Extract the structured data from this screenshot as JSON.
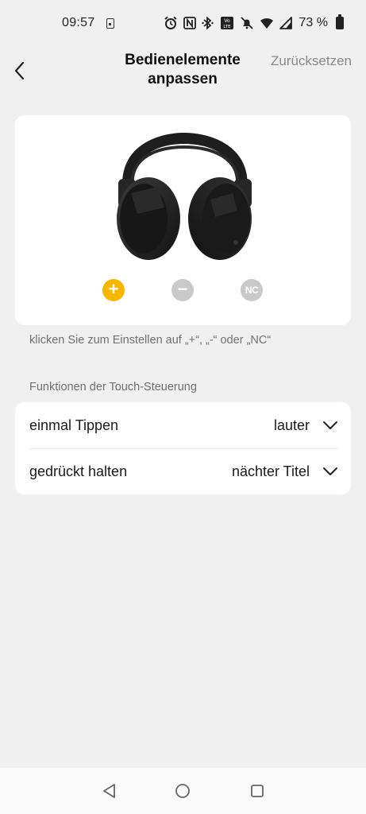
{
  "status_bar": {
    "time": "09:57",
    "battery_percent": "73 %",
    "icons": [
      "sim-card-icon",
      "alarm-icon",
      "nfc-icon",
      "bluetooth-icon",
      "volte-icon",
      "mute-icon",
      "wifi-icon",
      "signal-icon",
      "battery-icon"
    ]
  },
  "header": {
    "title_line1": "Bedienelemente",
    "title_line2": "anpassen",
    "reset_label": "Zurücksetzen",
    "back_icon": "chevron-left-icon"
  },
  "product": {
    "controls": {
      "plus": "+",
      "minus": "−",
      "nc": "NC",
      "active": "plus",
      "active_color": "#f5b700",
      "inactive_color": "#c9c9c9"
    }
  },
  "hint": "klicken Sie zum Einstellen auf „+“, „-“ oder „NC“",
  "section": {
    "label": "Funktionen der Touch-Steuerung",
    "rows": [
      {
        "label": "einmal Tippen",
        "value": "lauter"
      },
      {
        "label": "gedrückt halten",
        "value": "nächter Titel"
      }
    ]
  },
  "nav": {
    "icons": [
      "nav-back-icon",
      "nav-home-icon",
      "nav-recents-icon"
    ]
  }
}
